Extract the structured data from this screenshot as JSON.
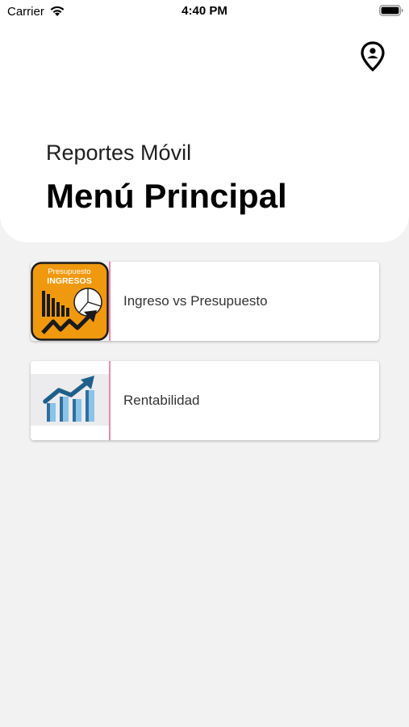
{
  "status_bar": {
    "carrier": "Carrier",
    "time": "4:40 PM"
  },
  "header": {
    "subtitle": "Reportes Móvil",
    "title": "Menú Principal",
    "location_icon": "location-pin-icon"
  },
  "menu": [
    {
      "label": "Ingreso vs Presupuesto",
      "thumb_line1": "Presupuesto",
      "thumb_line2": "INGRESOS",
      "thumb_color": "#f0990f"
    },
    {
      "label": "Rentabilidad",
      "thumb_color": "#2f6f9e"
    }
  ],
  "colors": {
    "background": "#f2f2f2",
    "card_divider": "#e88aa8"
  }
}
